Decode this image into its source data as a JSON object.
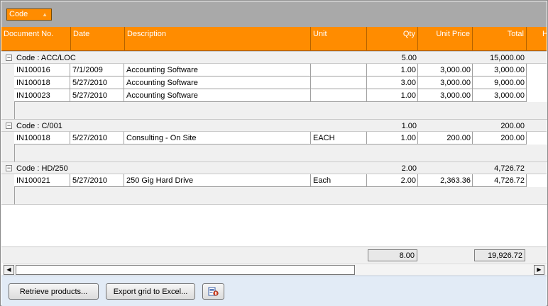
{
  "group_panel": {
    "chip_label": "Code"
  },
  "columns": [
    {
      "key": "doc",
      "label": "Document No."
    },
    {
      "key": "date",
      "label": "Date"
    },
    {
      "key": "desc",
      "label": "Description"
    },
    {
      "key": "unit",
      "label": "Unit"
    },
    {
      "key": "qty",
      "label": "Qty"
    },
    {
      "key": "price",
      "label": "Unit Price"
    },
    {
      "key": "total",
      "label": "Total"
    },
    {
      "key": "extra",
      "label": "H"
    }
  ],
  "groups": [
    {
      "label": "Code : ACC/LOC",
      "qty": "5.00",
      "total": "15,000.00",
      "rows": [
        {
          "doc": "IN100016",
          "date": "7/1/2009",
          "desc": "Accounting Software",
          "unit": "",
          "qty": "1.00",
          "price": "3,000.00",
          "total": "3,000.00"
        },
        {
          "doc": "IN100018",
          "date": "5/27/2010",
          "desc": "Accounting Software",
          "unit": "",
          "qty": "3.00",
          "price": "3,000.00",
          "total": "9,000.00"
        },
        {
          "doc": "IN100023",
          "date": "5/27/2010",
          "desc": "Accounting Software",
          "unit": "",
          "qty": "1.00",
          "price": "3,000.00",
          "total": "3,000.00"
        }
      ]
    },
    {
      "label": "Code : C/001",
      "qty": "1.00",
      "total": "200.00",
      "rows": [
        {
          "doc": "IN100018",
          "date": "5/27/2010",
          "desc": "Consulting - On Site",
          "unit": "EACH",
          "qty": "1.00",
          "price": "200.00",
          "total": "200.00"
        }
      ]
    },
    {
      "label": "Code : HD/250",
      "qty": "2.00",
      "total": "4,726.72",
      "rows": [
        {
          "doc": "IN100021",
          "date": "5/27/2010",
          "desc": "250 Gig Hard Drive",
          "unit": "Each",
          "qty": "2.00",
          "price": "2,363.36",
          "total": "4,726.72"
        }
      ]
    }
  ],
  "summary": {
    "qty": "8.00",
    "total": "19,926.72"
  },
  "buttons": {
    "retrieve": "Retrieve products...",
    "export": "Export grid to Excel...",
    "extra_icon": "print-preview-icon"
  },
  "colors": {
    "header": "#ff8c00",
    "group_panel": "#a9a9a9",
    "bottom_bar": "#e2ebf6"
  }
}
